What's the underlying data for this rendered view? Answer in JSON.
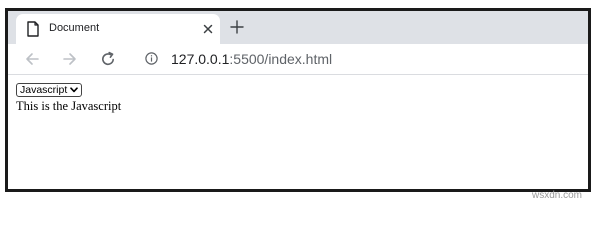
{
  "browser": {
    "tab": {
      "title": "Document"
    },
    "address_bar": {
      "url_host": "127.0.0.1",
      "url_rest": ":5500/index.html"
    }
  },
  "page": {
    "select": {
      "selected": "Javascript"
    },
    "text": "This is the Javascript"
  },
  "watermark": "wsxdn.com",
  "icons": {
    "favicon": "document-icon",
    "close": "close-icon",
    "new_tab": "plus-icon",
    "back": "arrow-left-icon",
    "forward": "arrow-right-icon",
    "reload": "reload-icon",
    "info": "info-icon",
    "select_chevron": "chevron-down-icon"
  },
  "colors": {
    "tabstrip": "#dee1e6",
    "disabled_icon": "#bdc1c6",
    "active_icon": "#5f6368"
  }
}
